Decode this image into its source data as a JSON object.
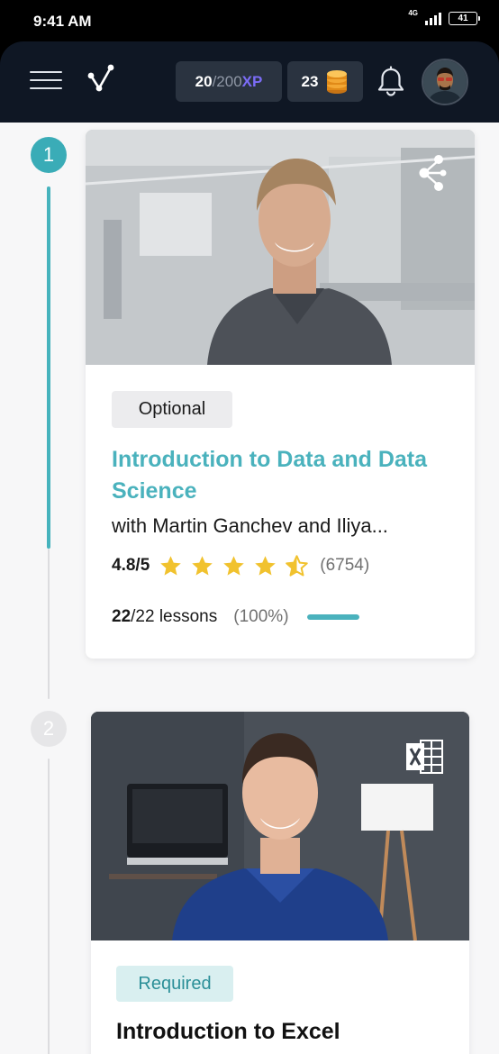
{
  "status_bar": {
    "time": "9:41 AM",
    "network": "4G",
    "battery": "41"
  },
  "header": {
    "xp_current": "20",
    "xp_max": "/200",
    "xp_label": "XP",
    "coins": "23"
  },
  "timeline": [
    {
      "step": "1",
      "badge": "Optional",
      "title": "Introduction to Data and Data Science",
      "authors": "with Martin Ganchev and Iliya...",
      "rating": "4.8/5",
      "stars": 4.5,
      "reviews": "(6754)",
      "lessons_done": "22",
      "lessons_total": "/22 lessons",
      "percent": "(100%)",
      "progress": 1.0,
      "icon": "share-nodes-icon"
    },
    {
      "step": "2",
      "badge": "Required",
      "title": "Introduction to Excel",
      "icon": "excel-icon"
    }
  ],
  "colors": {
    "accent": "#4ab2bd",
    "header_bg": "#0f1724",
    "xp": "#7b6cf6",
    "star": "#f1c22e"
  }
}
